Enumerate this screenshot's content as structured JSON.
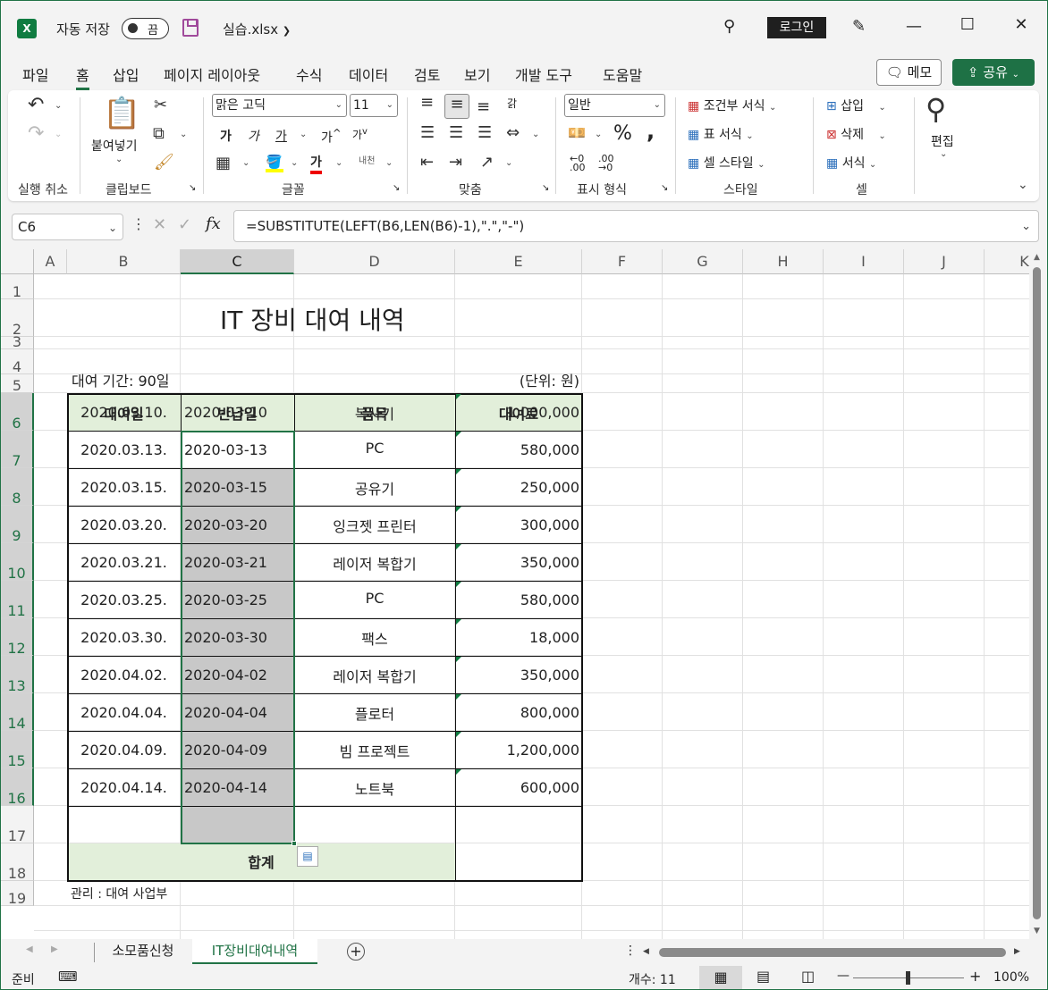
{
  "titlebar": {
    "logo": "X",
    "autosave_label": "자동 저장",
    "autosave_state": "끔",
    "filename": "실습.xlsx",
    "login": "로그인"
  },
  "menu": [
    "파일",
    "홈",
    "삽입",
    "페이지 레이아웃",
    "수식",
    "데이터",
    "검토",
    "보기",
    "개발 도구",
    "도움말"
  ],
  "menu_active": "홈",
  "comment_button": "메모",
  "share_button": "공유",
  "ribbon": {
    "groups": [
      "실행 취소",
      "클립보드",
      "글꼴",
      "맞춤",
      "표시 형식",
      "스타일",
      "셀"
    ],
    "paste": "붙여넣기",
    "font_name": "맑은 고딕",
    "font_size": "11",
    "number_format": "일반",
    "conditional_format": "조건부 서식",
    "table_format": "표 서식",
    "cell_style": "셀 스타일",
    "insert": "삽입",
    "delete": "삭제",
    "format": "서식",
    "edit": "편집",
    "bold": "가",
    "italic": "가",
    "underline": "가",
    "grow": "가",
    "shrink": "가",
    "fontcolor": "가",
    "phonetic": "내천",
    "wrap": "갉",
    "percent": "%",
    "comma": ","
  },
  "formula_bar": {
    "name_box": "C6",
    "formula": "=SUBSTITUTE(LEFT(B6,LEN(B6)-1),\".\",\"-\")"
  },
  "columns": [
    "A",
    "B",
    "C",
    "D",
    "E",
    "F",
    "G",
    "H",
    "I",
    "J",
    "K"
  ],
  "rows": [
    "1",
    "2",
    "3",
    "4",
    "5",
    "6",
    "7",
    "8",
    "9",
    "10",
    "11",
    "12",
    "13",
    "14",
    "15",
    "16",
    "17",
    "18",
    "19"
  ],
  "sheet": {
    "title": "IT 장비 대여 내역",
    "period": "대여 기간: 90일",
    "unit": "(단위: 원)",
    "headers": [
      "대여일",
      "반납일",
      "품목",
      "대여료"
    ],
    "records": [
      {
        "rent": "2020.03.10.",
        "ret": "2020-03-10",
        "item": "복사기",
        "fee": "1,000,000"
      },
      {
        "rent": "2020.03.13.",
        "ret": "2020-03-13",
        "item": "PC",
        "fee": "580,000"
      },
      {
        "rent": "2020.03.15.",
        "ret": "2020-03-15",
        "item": "공유기",
        "fee": "250,000"
      },
      {
        "rent": "2020.03.20.",
        "ret": "2020-03-20",
        "item": "잉크젯 프린터",
        "fee": "300,000"
      },
      {
        "rent": "2020.03.21.",
        "ret": "2020-03-21",
        "item": "레이저 복합기",
        "fee": "350,000"
      },
      {
        "rent": "2020.03.25.",
        "ret": "2020-03-25",
        "item": "PC",
        "fee": "580,000"
      },
      {
        "rent": "2020.03.30.",
        "ret": "2020-03-30",
        "item": "팩스",
        "fee": "18,000"
      },
      {
        "rent": "2020.04.02.",
        "ret": "2020-04-02",
        "item": "레이저 복합기",
        "fee": "350,000"
      },
      {
        "rent": "2020.04.04.",
        "ret": "2020-04-04",
        "item": "플로터",
        "fee": "800,000"
      },
      {
        "rent": "2020.04.09.",
        "ret": "2020-04-09",
        "item": "빔 프로젝트",
        "fee": "1,200,000"
      },
      {
        "rent": "2020.04.14.",
        "ret": "2020-04-14",
        "item": "노트북",
        "fee": "600,000"
      }
    ],
    "total_label": "합계",
    "footer": "관리 : 대여 사업부"
  },
  "tabs": [
    "소모품신청",
    "IT장비대여내역"
  ],
  "active_tab": "IT장비대여내역",
  "status": {
    "mode": "준비",
    "count": "개수: 11",
    "zoom": "100%"
  },
  "colors": {
    "excel_green": "#217346",
    "header_fill": "#e2efda",
    "selection_gray": "#c8c8c8"
  }
}
